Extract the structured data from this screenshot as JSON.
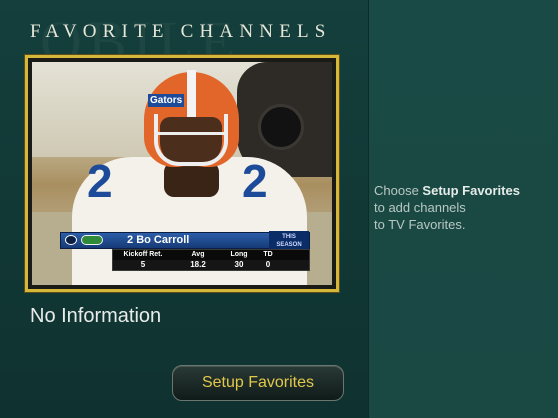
{
  "screen": {
    "title": "FAVORITE CHANNELS",
    "watermark": "OBILE"
  },
  "preview": {
    "status_text": "No Information",
    "scoreboard": {
      "number": "2",
      "name": "Bo Carroll",
      "season_label": "THIS SEASON",
      "headers": [
        "Kickoff Ret.",
        "Avg",
        "Long",
        "TD"
      ],
      "values": [
        "5",
        "18.2",
        "30",
        "0"
      ]
    },
    "helmet_decal": "Gators",
    "jersey_number": "2"
  },
  "actions": {
    "setup_button_label": "Setup Favorites"
  },
  "help": {
    "line1_prefix": "Choose ",
    "line1_bold": "Setup Favorites",
    "line2": "to add channels",
    "line3": "to TV Favorites."
  },
  "colors": {
    "accent_gold": "#d5b83a",
    "button_text": "#e2c84a",
    "background": "#143f3c"
  }
}
